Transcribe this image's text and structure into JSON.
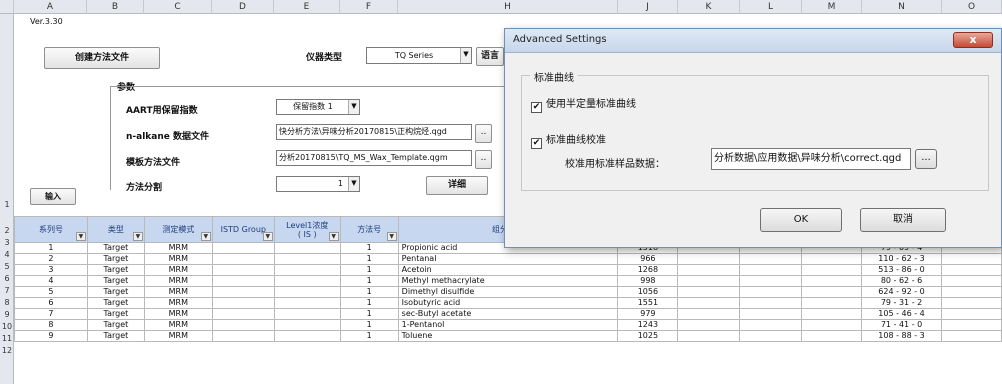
{
  "column_headers": [
    "A",
    "B",
    "C",
    "D",
    "E",
    "F",
    "H",
    "J",
    "K",
    "L",
    "M",
    "N",
    "O"
  ],
  "row_headers": [
    "1",
    "2",
    "3",
    "4",
    "5",
    "6",
    "7",
    "8",
    "9",
    "10",
    "11",
    "12"
  ],
  "sheet": {
    "version": "Ver.3.30",
    "create_method_button": "创建方法文件",
    "instrument_type_label": "仪器类型",
    "instrument_type_value": "TQ Series",
    "language_button": "语言",
    "params_label": "参数",
    "aart_label": "AART用保留指数",
    "aart_value": "保留指数 1",
    "alkane_label": "n-alkane 数据文件",
    "alkane_value": "快分析方法\\异味分析20170815\\正构烷烃.qgd",
    "template_label": "模板方法文件",
    "template_value": "分析20170815\\TQ_MS_Wax_Template.qgm",
    "browse_label": "..",
    "split_label": "方法分割",
    "split_value": "1",
    "detail_button": "详细",
    "import_button": "输入"
  },
  "table": {
    "headers": [
      "系列号",
      "类型",
      "测定模式",
      "ISTD Group",
      "Level1浓度\n( IS )",
      "方法号",
      "组分名称",
      "",
      "",
      "",
      "",
      "",
      ""
    ],
    "rows": [
      [
        "1",
        "Target",
        "MRM",
        "",
        "",
        "1",
        "Propionic acid",
        "1518",
        "",
        "",
        "",
        "79 - 09 - 4",
        ""
      ],
      [
        "2",
        "Target",
        "MRM",
        "",
        "",
        "1",
        "Pentanal",
        "966",
        "",
        "",
        "",
        "110 - 62 - 3",
        ""
      ],
      [
        "3",
        "Target",
        "MRM",
        "",
        "",
        "1",
        "Acetoin",
        "1268",
        "",
        "",
        "",
        "513 - 86 - 0",
        ""
      ],
      [
        "4",
        "Target",
        "MRM",
        "",
        "",
        "1",
        "Methyl methacrylate",
        "998",
        "",
        "",
        "",
        "80 - 62 - 6",
        ""
      ],
      [
        "5",
        "Target",
        "MRM",
        "",
        "",
        "1",
        "Dimethyl disulfide",
        "1056",
        "",
        "",
        "",
        "624 - 92 - 0",
        ""
      ],
      [
        "6",
        "Target",
        "MRM",
        "",
        "",
        "1",
        "Isobutyric acid",
        "1551",
        "",
        "",
        "",
        "79 - 31 - 2",
        ""
      ],
      [
        "7",
        "Target",
        "MRM",
        "",
        "",
        "1",
        "sec-Butyl acetate",
        "979",
        "",
        "",
        "",
        "105 - 46 - 4",
        ""
      ],
      [
        "8",
        "Target",
        "MRM",
        "",
        "",
        "1",
        "1-Pentanol",
        "1243",
        "",
        "",
        "",
        "71 - 41 - 0",
        ""
      ],
      [
        "9",
        "Target",
        "MRM",
        "",
        "",
        "1",
        "Toluene",
        "1025",
        "",
        "",
        "",
        "108 - 88 - 3",
        ""
      ]
    ]
  },
  "dialog": {
    "title": "Advanced Settings",
    "close_label": "x",
    "group_title": "标准曲线",
    "checkbox1_label": "使用半定量标准曲线",
    "checkbox2_label": "标准曲线校准",
    "checkbox_mark": "✔",
    "calib_label": "校准用标准样品数据：",
    "calib_value": "分析数据\\应用数据\\异味分析\\correct.qgd",
    "browse_label": "...",
    "ok_button": "OK",
    "cancel_button": "取消"
  }
}
